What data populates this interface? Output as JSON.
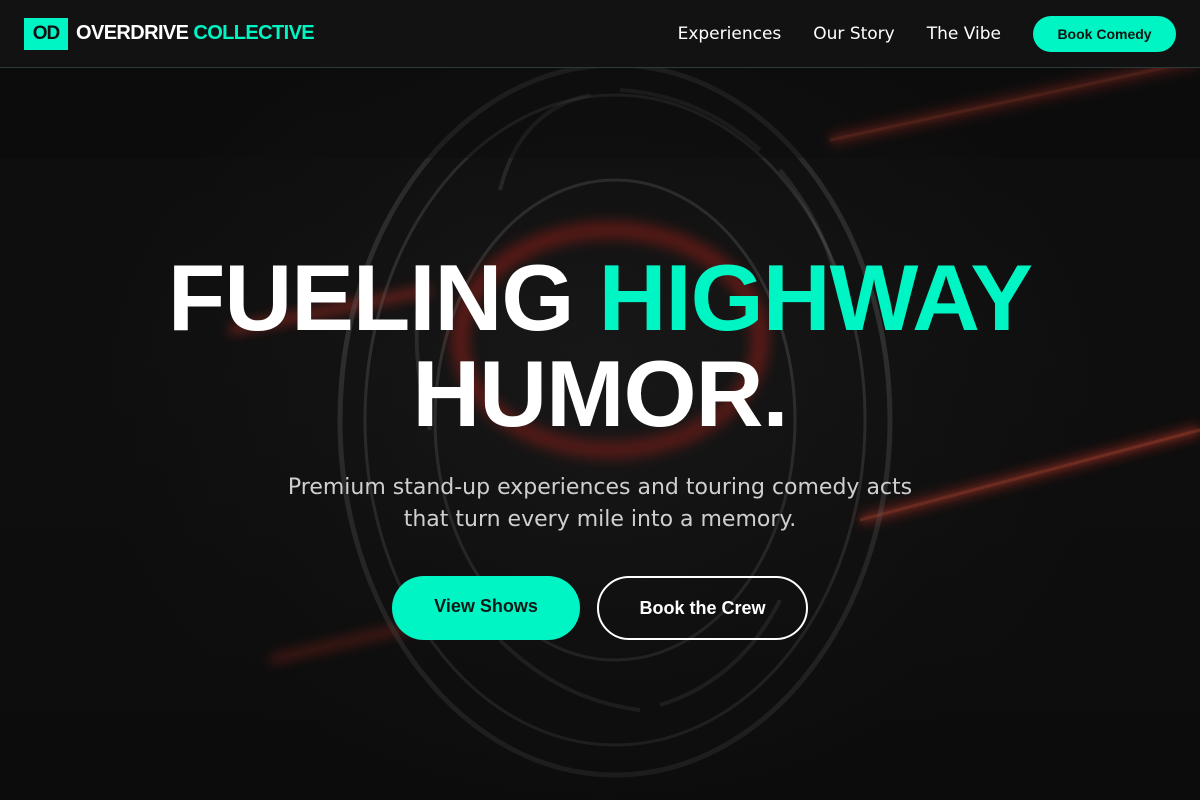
{
  "brand": {
    "mark": "OD",
    "name_primary": "OVERDRIVE",
    "name_accent": "COLLECTIVE"
  },
  "nav": {
    "links": [
      "Experiences",
      "Our Story",
      "The Vibe"
    ],
    "cta_label": "Book Comedy"
  },
  "hero": {
    "headline_part1": "FUELING",
    "headline_accent": "HIGHWAY",
    "headline_part2": "HUMOR.",
    "subtitle": "Premium stand-up experiences and touring comedy acts that turn every mile into a memory.",
    "primary_button": "View Shows",
    "secondary_button": "Book the Crew"
  },
  "colors": {
    "accent": "#00f5c4",
    "background": "#0f0f0f",
    "neon_red": "#ff3a2a"
  },
  "background_image": {
    "icon": "neon-comedy-sign-icon"
  }
}
